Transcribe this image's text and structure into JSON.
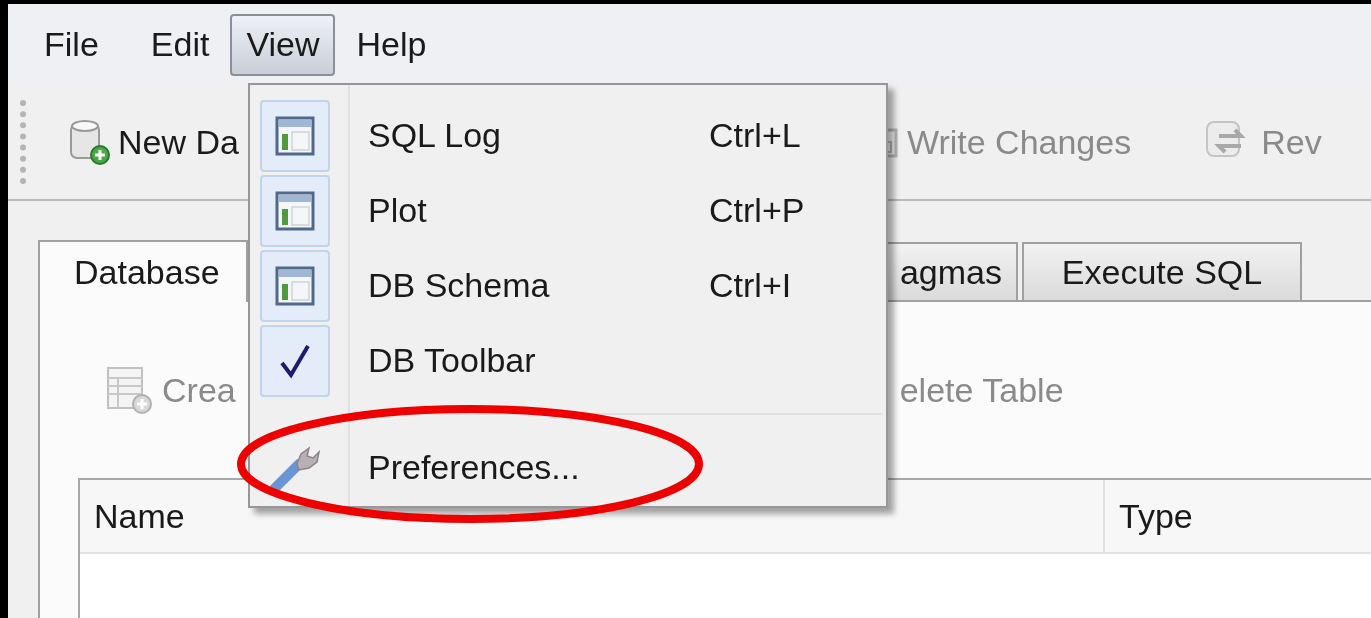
{
  "menu_bar": [
    {
      "label": "File",
      "selected": false
    },
    {
      "label": "Edit",
      "selected": false
    },
    {
      "label": "View",
      "selected": true
    },
    {
      "label": "Help",
      "selected": false
    }
  ],
  "toolbar": [
    {
      "label": "New Da",
      "kind": "new-database",
      "disabled": false
    },
    {
      "label": "Write Changes",
      "kind": "write",
      "disabled": true
    },
    {
      "label": "Rev",
      "kind": "revert",
      "disabled": true
    }
  ],
  "tabs": [
    {
      "label": "Database",
      "selected": true
    },
    {
      "label": "agmas",
      "selected": false
    },
    {
      "label": "Execute SQL",
      "selected": false
    }
  ],
  "structure_toolbar": [
    {
      "label": "Crea",
      "kind": "create",
      "disabled": true
    },
    {
      "label": "elete Table",
      "kind": "delete",
      "disabled": true
    }
  ],
  "table": {
    "columns": [
      "Name",
      "Type"
    ]
  },
  "view_menu": {
    "items": [
      {
        "label": "SQL Log",
        "shortcut": "Ctrl+L",
        "kind": "panel",
        "checked": true
      },
      {
        "label": "Plot",
        "shortcut": "Ctrl+P",
        "kind": "panel",
        "checked": true
      },
      {
        "label": "DB Schema",
        "shortcut": "Ctrl+I",
        "kind": "panel",
        "checked": true
      },
      {
        "label": "DB Toolbar",
        "kind": "toggle",
        "checked": true
      },
      {
        "label": "Preferences...",
        "kind": "wrench",
        "checked": false,
        "separator_before": true
      }
    ]
  }
}
